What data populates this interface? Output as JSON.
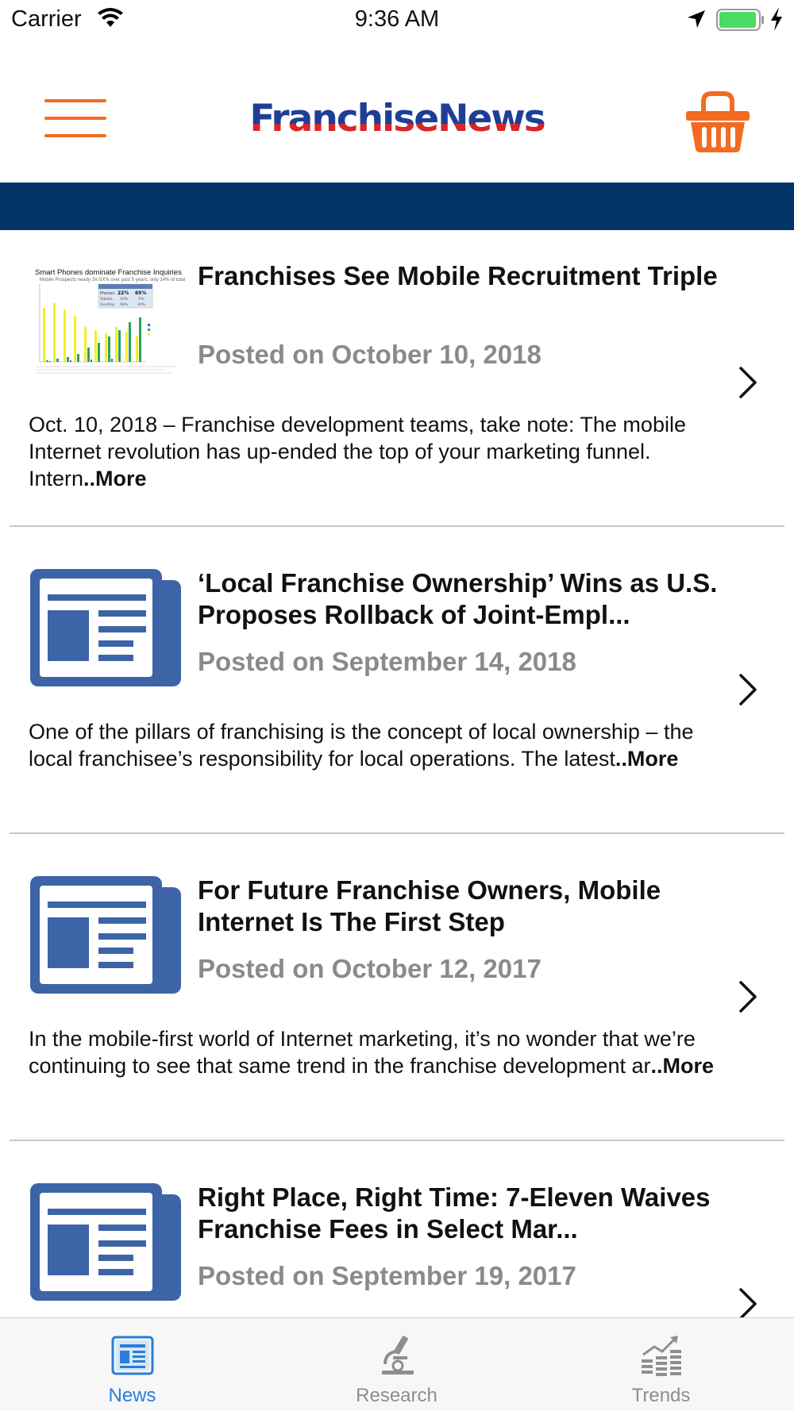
{
  "status_bar": {
    "carrier": "Carrier",
    "time": "9:36 AM",
    "icons": [
      "wifi-icon",
      "location-arrow-icon",
      "battery-icon",
      "charging-bolt-icon"
    ]
  },
  "header": {
    "logo_text": "FranchiseNews",
    "menu_icon": "hamburger-menu-icon",
    "cart_icon": "shopping-basket-icon"
  },
  "colors": {
    "accent_orange": "#f26b21",
    "nav_band": "#02346a",
    "logo_blue": "#1f3f96",
    "logo_red": "#d7262b",
    "tab_active": "#2a7dd8",
    "tab_inactive": "#8e8e8e",
    "date_gray": "#8a8a8a",
    "news_icon_blue": "#3d64a6"
  },
  "articles": [
    {
      "title": "Franchises See Mobile Recruitment Triple",
      "date": "Posted on October 10, 2018",
      "excerpt": "Oct. 10, 2018 – Franchise development teams, take note: The mobile Internet revolution has up-ended the top of your marketing funnel. Intern",
      "more": "..More",
      "thumbnail": "chart",
      "thumb_title": "Smart Phones dominate Franchise Inquiries",
      "thumb_subtitle": "Mobile Prospects nearly 3X-5X% over past 5 years, only 24% of total"
    },
    {
      "title": "‘Local Franchise Ownership’ Wins as U.S. Proposes Rollback of Joint-Empl...",
      "date": "Posted on September 14, 2018",
      "excerpt": "One of the pillars of franchising is the concept of local ownership – the local franchisee’s responsibility for local operations. The latest",
      "more": "..More",
      "thumbnail": "newspaper-icon"
    },
    {
      "title": "For Future Franchise Owners, Mobile Internet Is The First Step",
      "date": "Posted on October 12, 2017",
      "excerpt": "In the mobile-first world of Internet marketing, it’s no wonder that we’re continuing to see that same trend in the franchise development ar",
      "more": "..More",
      "thumbnail": "newspaper-icon"
    },
    {
      "title": "Right Place, Right Time: 7-Eleven Waives Franchise Fees in Select Mar...",
      "date": "Posted on September 19, 2017",
      "excerpt": "",
      "more": "",
      "thumbnail": "newspaper-icon"
    }
  ],
  "tabs": [
    {
      "label": "News",
      "icon": "news-tab-icon",
      "active": true
    },
    {
      "label": "Research",
      "icon": "microscope-icon",
      "active": false
    },
    {
      "label": "Trends",
      "icon": "trends-chart-icon",
      "active": false
    }
  ]
}
